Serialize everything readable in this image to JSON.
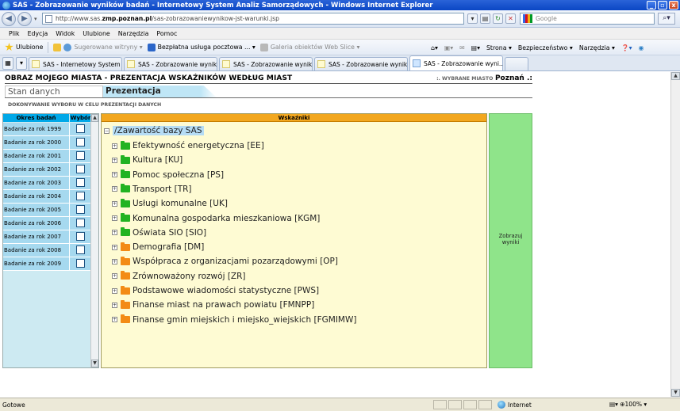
{
  "window": {
    "title": "SAS - Zobrazowanie wyników badań - Internetowy System Analiz Samorządowych - Windows Internet Explorer",
    "min_symbol": "_",
    "max_symbol": "▫",
    "close_symbol": "x"
  },
  "address": {
    "url_prefix": "http://www.sas.",
    "url_bold": "zmp.poznan.pl",
    "url_suffix": "/sas-zobrazowaniewynikow-jst-warunki.jsp",
    "search_placeholder": "Google"
  },
  "menu": [
    "Plik",
    "Edycja",
    "Widok",
    "Ulubione",
    "Narzędzia",
    "Pomoc"
  ],
  "favorites": {
    "favorites_label": "Ulubione",
    "suggested_sites": "Sugerowane witryny ▾",
    "free_mail": "Bezpłatna usługa pocztowa ... ▾",
    "web_slice": "Galeria obiektów Web Slice ▾",
    "command_page": "Strona ▾",
    "command_security": "Bezpieczeństwo ▾",
    "command_tools": "Narzędzia ▾"
  },
  "ie_tabs": [
    {
      "label": "SAS - Internetowy System A..."
    },
    {
      "label": "SAS - Zobrazowanie wynikó..."
    },
    {
      "label": "SAS - Zobrazowanie wynikó..."
    },
    {
      "label": "SAS - Zobrazowanie wynikó..."
    },
    {
      "label": "SAS - Zobrazowanie wyni...",
      "active": true
    }
  ],
  "page": {
    "title": "OBRAZ MOJEGO MIASTA - PREZENTACJA WSKAŹNIKÓW WEDŁUG MIAST",
    "city_label": ":. WYBRANE MIASTO",
    "city_value": "Poznań .:",
    "tabs": {
      "data_state": "Stan danych",
      "presentation": "Prezentacja"
    },
    "section_caption": "DOKONYWANIE WYBORU W CELU PREZENTACJI DANYCH"
  },
  "periods": {
    "header_period": "Okres badań",
    "header_choice": "Wybór",
    "rows": [
      "Badanie za rok 1999",
      "Badanie za rok 2000",
      "Badanie za rok 2001",
      "Badanie za rok 2002",
      "Badanie za rok 2003",
      "Badanie za rok 2004",
      "Badanie za rok 2005",
      "Badanie za rok 2006",
      "Badanie za rok 2007",
      "Badanie za rok 2008",
      "Badanie za rok 2009"
    ]
  },
  "indicators": {
    "header": "Wskaźniki",
    "root": "/Zawartość bazy SAS",
    "items": [
      {
        "label": "Efektywność energetyczna [EE]",
        "color": "#22b322"
      },
      {
        "label": "Kultura [KU]",
        "color": "#22b322"
      },
      {
        "label": "Pomoc społeczna [PS]",
        "color": "#22b322"
      },
      {
        "label": "Transport [TR]",
        "color": "#22b322"
      },
      {
        "label": "Usługi komunalne [UK]",
        "color": "#22b322"
      },
      {
        "label": "Komunalna gospodarka mieszkaniowa [KGM]",
        "color": "#22b322"
      },
      {
        "label": "Oświata SIO [SIO]",
        "color": "#22b322"
      },
      {
        "label": "Demografia [DM]",
        "color": "#f38b16"
      },
      {
        "label": "Współpraca z organizacjami pozarządowymi [OP]",
        "color": "#f38b16"
      },
      {
        "label": "Zrównoważony rozwój [ZR]",
        "color": "#f38b16"
      },
      {
        "label": "Podstawowe wiadomości statystyczne [PWS]",
        "color": "#f38b16"
      },
      {
        "label": "Finanse miast na prawach powiatu [FMNPP]",
        "color": "#f38b16"
      },
      {
        "label": "Finanse gmin miejskich i miejsko_wiejskich [FGMIMW]",
        "color": "#f38b16"
      }
    ]
  },
  "actions": {
    "show_results_line1": "Zobrazuj",
    "show_results_line2": "wyniki"
  },
  "status": {
    "text": "Gotowe",
    "zone": "Internet",
    "zoom": "⊕100% ▾"
  }
}
